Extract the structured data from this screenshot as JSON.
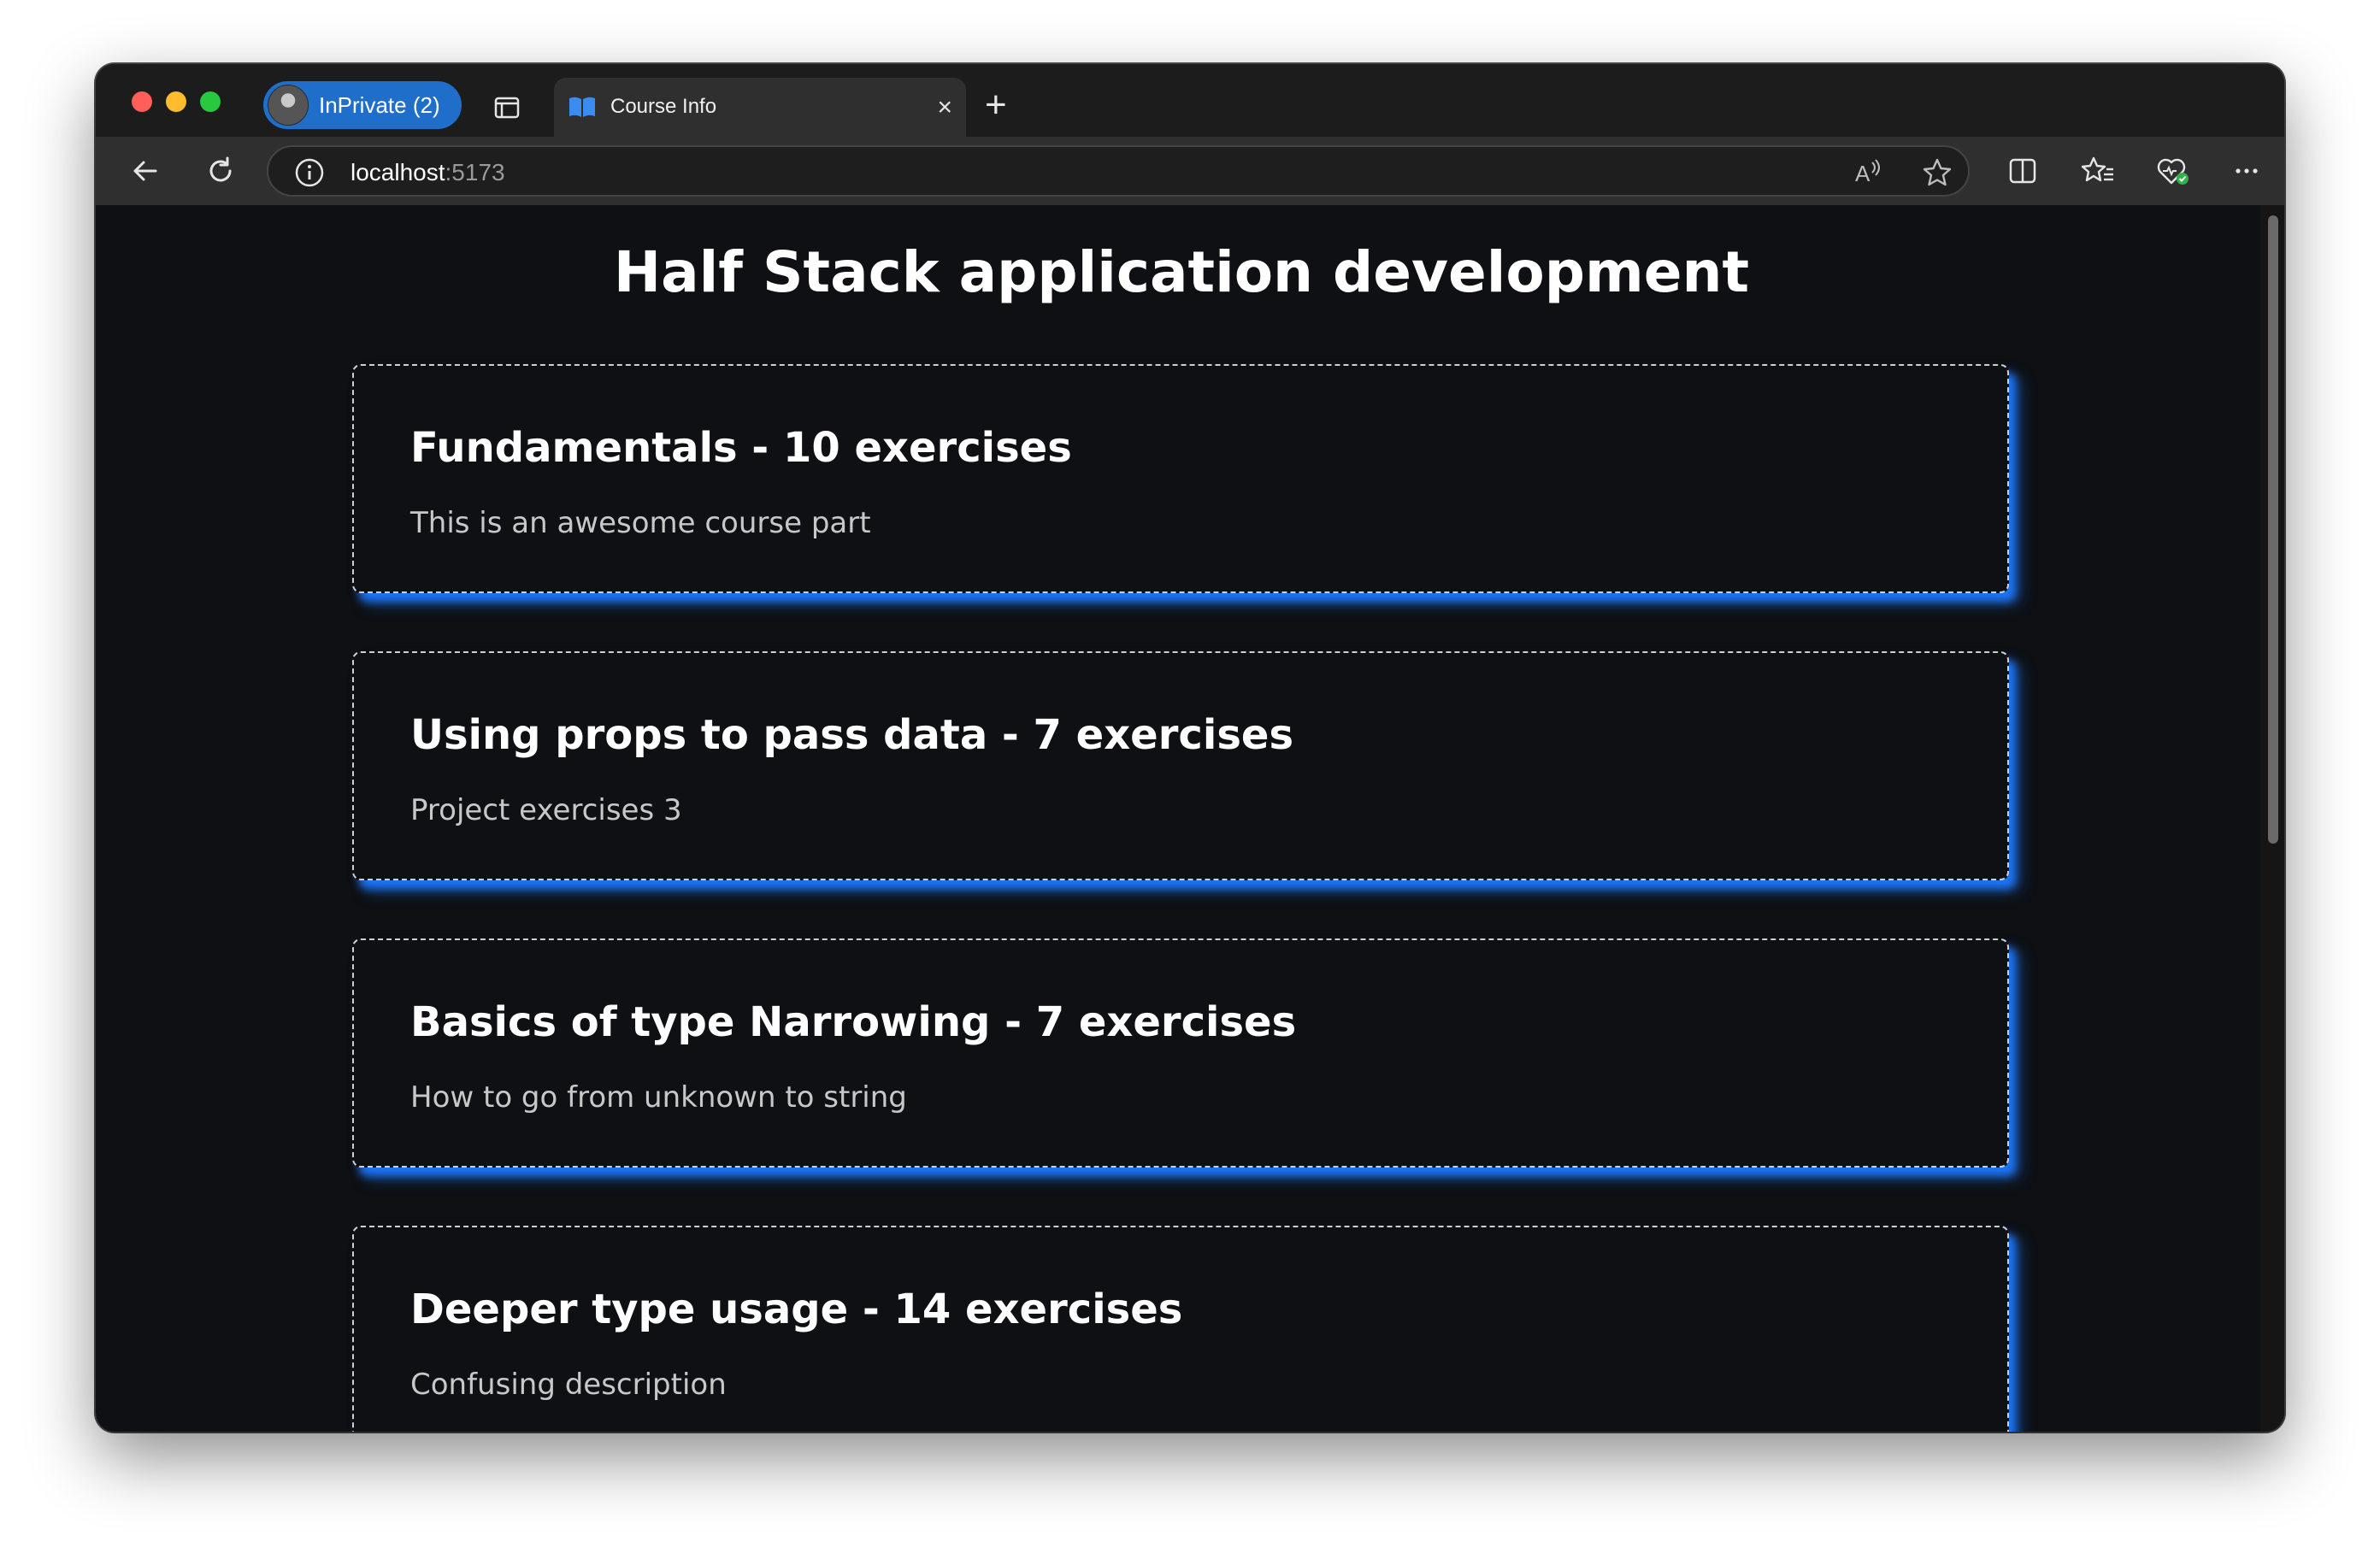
{
  "browser": {
    "profile_label": "InPrivate (2)",
    "tab_title": "Course Info",
    "url_host": "localhost",
    "url_port": ":5173",
    "icons": {
      "back": "back-arrow-icon",
      "refresh": "refresh-icon",
      "info": "info-icon",
      "read_aloud": "read-aloud-icon",
      "favorite": "star-icon",
      "split": "split-screen-icon",
      "favorites": "favorites-icon",
      "health": "browser-essentials-icon",
      "more": "more-icon"
    },
    "accent_color": "#1f6ec9"
  },
  "page": {
    "title": "Half Stack application development",
    "parts": [
      {
        "heading": "Fundamentals - 10 exercises",
        "description": "This is an awesome course part"
      },
      {
        "heading": "Using props to pass data - 7 exercises",
        "description": "Project exercises 3"
      },
      {
        "heading": "Basics of type Narrowing - 7 exercises",
        "description": "How to go from unknown to string"
      },
      {
        "heading": "Deeper type usage - 14 exercises",
        "description": "Confusing description"
      }
    ],
    "card_glow_color": "#1e78ff"
  }
}
